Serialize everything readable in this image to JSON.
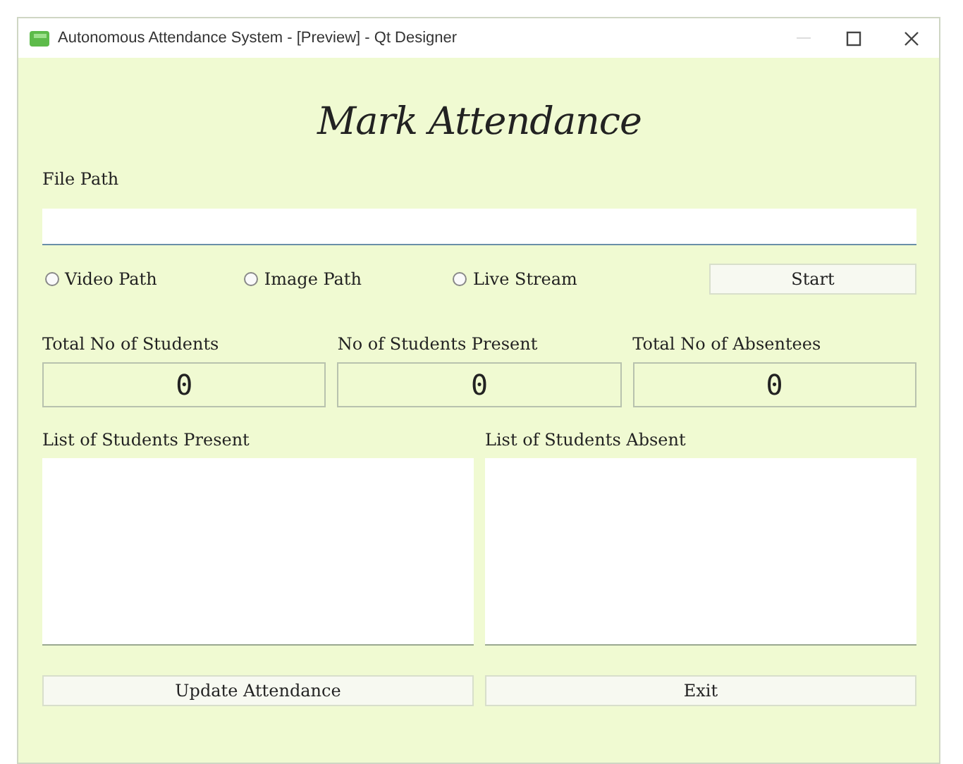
{
  "window": {
    "title": "Autonomous Attendance System - [Preview] - Qt Designer"
  },
  "heading": "Mark Attendance",
  "file_path": {
    "label": "File Path"
  },
  "sources": [
    {
      "label": "Video Path",
      "selected": false
    },
    {
      "label": "Image Path",
      "selected": false
    },
    {
      "label": "Live Stream",
      "selected": false
    }
  ],
  "start_button": "Start",
  "counters": [
    {
      "label": "Total No of Students",
      "value": "0"
    },
    {
      "label": "No of Students Present",
      "value": "0"
    },
    {
      "label": "Total No of Absentees",
      "value": "0"
    }
  ],
  "lists": [
    {
      "label": "List of Students Present"
    },
    {
      "label": "List of Students Absent"
    }
  ],
  "buttons": [
    "Update Attendance",
    "Exit"
  ]
}
